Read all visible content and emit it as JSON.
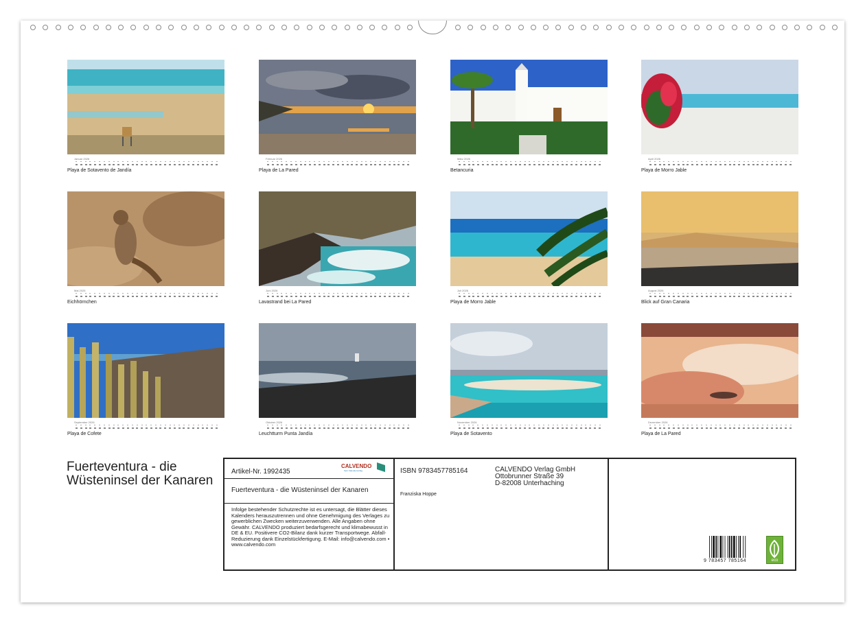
{
  "months": [
    {
      "name": "Januar 2026",
      "caption": "Playa de Sotavento de Jandía",
      "scene": "beach-lifeguard"
    },
    {
      "name": "Februar 2026",
      "caption": "Playa de La Pared",
      "scene": "sunset-coast"
    },
    {
      "name": "März 2026",
      "caption": "Betancuria",
      "scene": "white-church-palm"
    },
    {
      "name": "April 2026",
      "caption": "Playa de Morro Jable",
      "scene": "beach-bougainvillea"
    },
    {
      "name": "Mai 2026",
      "caption": "Eichhörnchen",
      "scene": "ground-squirrel"
    },
    {
      "name": "Juni 2026",
      "caption": "Lavastrand bei La Pared",
      "scene": "lava-cove"
    },
    {
      "name": "Juli 2026",
      "caption": "Playa de Morro Jable",
      "scene": "palm-turquoise-sea"
    },
    {
      "name": "August 2026",
      "caption": "Blick auf Gran Canaria",
      "scene": "hazy-golden-sea"
    },
    {
      "name": "September 2026",
      "caption": "Playa de Cofete",
      "scene": "cactus-coast"
    },
    {
      "name": "Oktober 2026",
      "caption": "Leuchtturm Punta Jandía",
      "scene": "lighthouse-rocks"
    },
    {
      "name": "November 2026",
      "caption": "Playa de Sotavento",
      "scene": "lagoon-view"
    },
    {
      "name": "Dezember 2026",
      "caption": "Playa de La Pared",
      "scene": "warm-toned-surf"
    }
  ],
  "product": {
    "title": "Fuerteventura - die Wüsteninsel der Kanaren",
    "article": "Artikel-Nr. 1992435",
    "box_title": "Fuerteventura - die Wüsteninsel der Kanaren",
    "legal": "Infolge bestehender Schutzrechte ist es untersagt, die Blätter dieses Kalenders herauszutrennen und ohne Genehmigung des Verlages zu gewerblichen Zwecken weiterzuverwenden. Alle Angaben ohne Gewähr. CALVENDO produziert bedarfsgerecht und klimabewusst in DE & EU. Positivere CO2-Bilanz dank kurzer Transportwege. Abfall-Reduzierung dank Einzelstückfertigung. E-Mail: info@calvendo.com • www.calvendo.com",
    "isbn": "ISBN 9783457785164",
    "author": "Franziska Hoppe",
    "publisher": [
      "CALVENDO Verlag GmbH",
      "Ottobrunner Straße 39",
      "D-82008 Unterhaching"
    ],
    "barcode_number": "9 783457 785164",
    "logo": "CALVENDO",
    "logo_sub": "Sein Kalenderverlag",
    "eco_label": "eco"
  }
}
